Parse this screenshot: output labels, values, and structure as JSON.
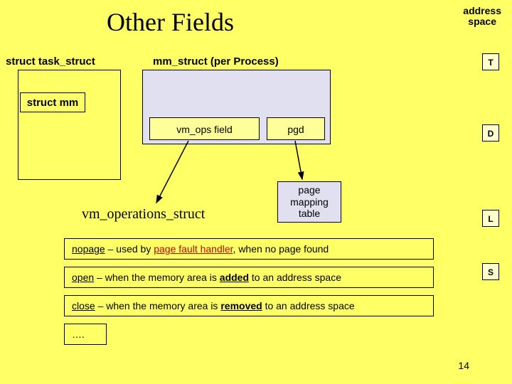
{
  "title": "Other   Fields",
  "addressSpace": "address\nspace",
  "sidebar": {
    "t": "T",
    "d": "D",
    "l": "L",
    "s": "S"
  },
  "labels": {
    "taskStruct": "struct task_struct",
    "structMm": "struct mm",
    "mmStruct": "mm_struct (per Process)",
    "vmOps": "vm_ops field",
    "pgd": "pgd",
    "pageMapping": "page\nmapping\ntable",
    "vmOperations": "vm_operations_struct"
  },
  "descriptions": {
    "nopage": {
      "keyword": "nopage",
      "sep": " – used by ",
      "emph": "page fault handler",
      "rest": ", when no page found"
    },
    "open": {
      "keyword": "open",
      "sep": " – when the memory area is ",
      "emph": "added",
      "rest": " to an address space"
    },
    "close": {
      "keyword": "close",
      "sep": " – when the memory area is ",
      "emph": "removed",
      "rest": " to an address space"
    },
    "more": "…."
  },
  "pageNumber": "14"
}
